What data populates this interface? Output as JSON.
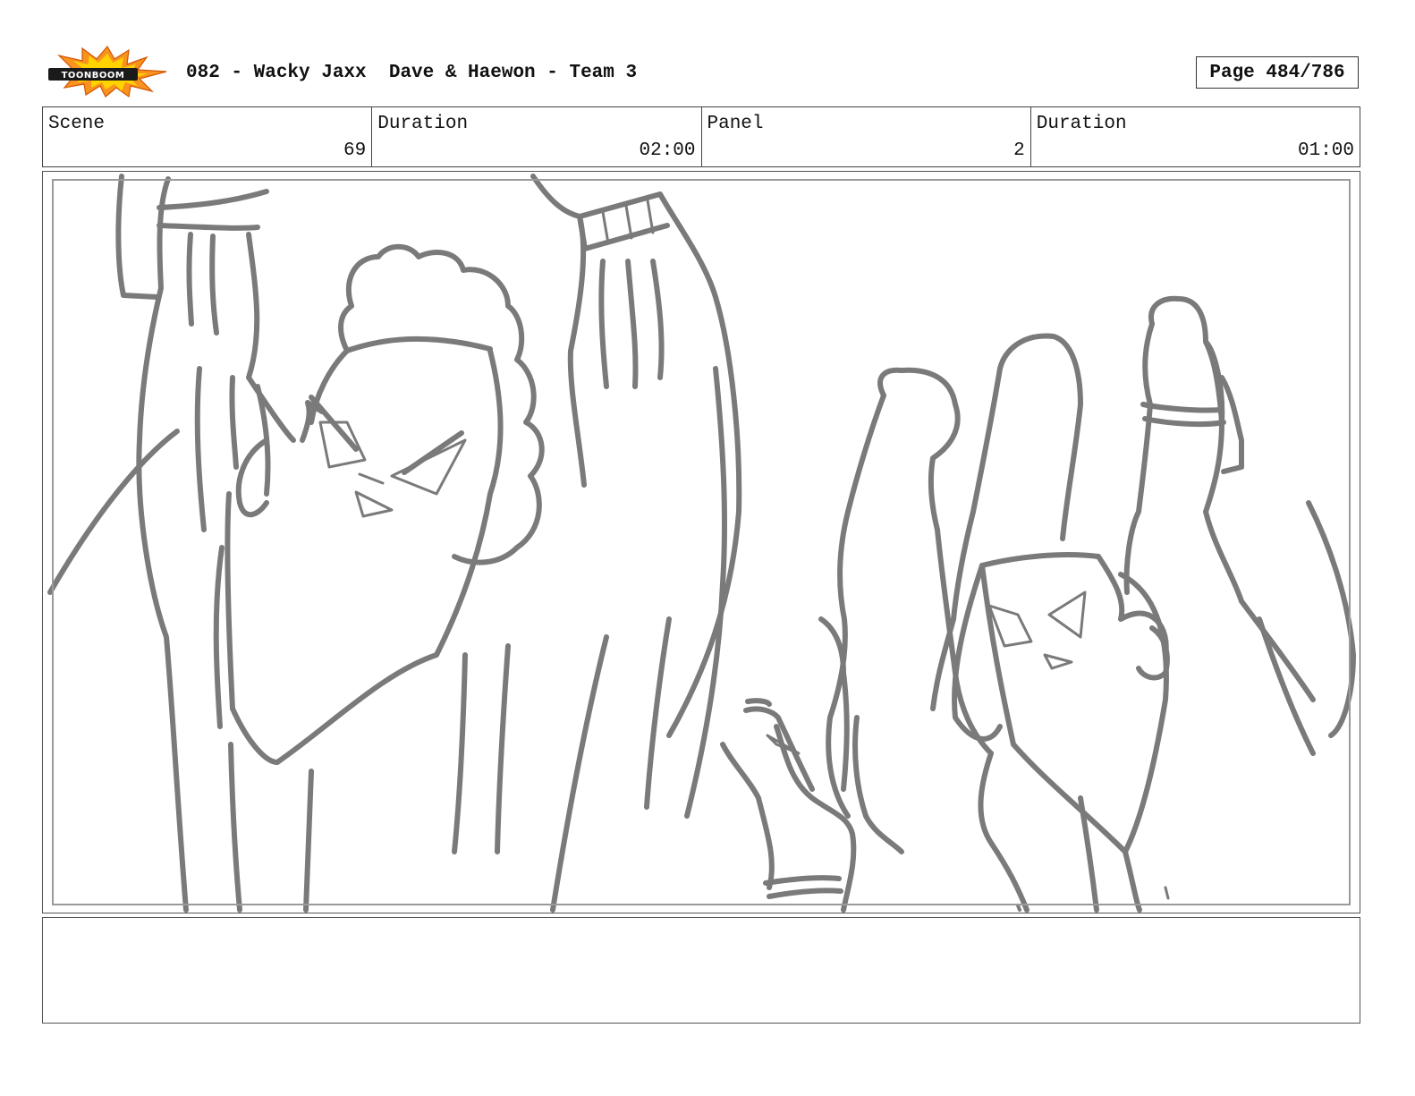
{
  "header": {
    "logo_text": "TOONBOOM",
    "title": "082 - Wacky Jaxx  Dave & Haewon - Team 3",
    "page_label": "Page 484/786"
  },
  "info": {
    "scene_label": "Scene",
    "scene_value": "69",
    "scene_duration_label": "Duration",
    "scene_duration_value": "02:00",
    "panel_label": "Panel",
    "panel_value": "2",
    "panel_duration_label": "Duration",
    "panel_duration_value": "01:00"
  },
  "panel": {
    "image": "storyboard-sketch"
  },
  "colors": {
    "sketch_stroke": "#7a7a7a",
    "logo_burst": "#f7931e",
    "logo_burst_inner": "#ffd200"
  }
}
